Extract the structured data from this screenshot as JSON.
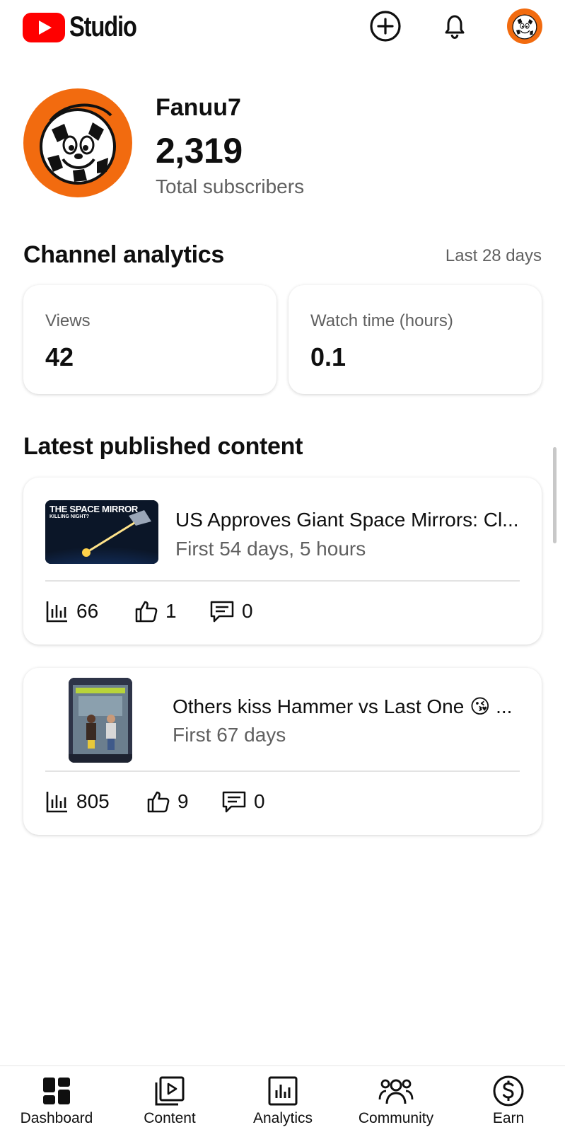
{
  "app": {
    "logo_text": "Studio",
    "brand_color": "#ff0000"
  },
  "header": {
    "icons": [
      "create-plus-icon",
      "notifications-bell-icon",
      "account-avatar"
    ]
  },
  "channel": {
    "name": "Fanuu7",
    "subscriber_count": "2,319",
    "subscriber_label": "Total subscribers",
    "avatar_color": "#f26b0f"
  },
  "analytics": {
    "title": "Channel analytics",
    "range": "Last 28 days",
    "stats": [
      {
        "label": "Views",
        "value": "42"
      },
      {
        "label": "Watch time (hours)",
        "value": "0.1"
      }
    ]
  },
  "latest": {
    "title": "Latest published content",
    "items": [
      {
        "thumbnail_title": "THE SPACE MIRROR",
        "thumbnail_subtitle": "KILLING NIGHT?",
        "title": "US Approves Giant Space Mirrors: Cl...",
        "subtitle": "First 54 days, 5 hours",
        "views": "66",
        "likes": "1",
        "comments": "0"
      },
      {
        "title": "Others kiss Hammer vs Last One 😘 ...",
        "subtitle": "First 67 days",
        "views": "805",
        "likes": "9",
        "comments": "0"
      }
    ]
  },
  "nav": {
    "items": [
      {
        "label": "Dashboard",
        "icon": "dashboard-icon"
      },
      {
        "label": "Content",
        "icon": "content-icon"
      },
      {
        "label": "Analytics",
        "icon": "analytics-icon"
      },
      {
        "label": "Community",
        "icon": "community-icon"
      },
      {
        "label": "Earn",
        "icon": "earn-icon"
      }
    ]
  }
}
